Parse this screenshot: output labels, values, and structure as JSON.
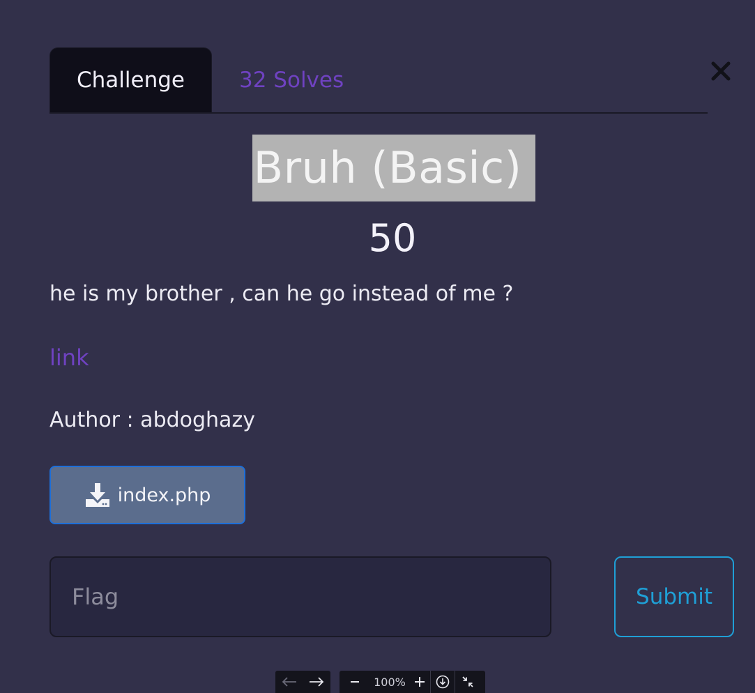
{
  "tabs": {
    "challenge": "Challenge",
    "solves": "32 Solves"
  },
  "challenge": {
    "title": "Bruh (Basic)",
    "points": "50",
    "description": "he is my brother , can he go instead of me ?",
    "link_text": "link",
    "author": "Author : abdoghazy"
  },
  "files": {
    "file_name": "index.php"
  },
  "form": {
    "flag_placeholder": "Flag",
    "submit_label": "Submit"
  },
  "viewer": {
    "zoom": "100%"
  },
  "colors": {
    "background": "#32304a",
    "accent_purple": "#6f42c1",
    "submit_blue": "#1f9fd6"
  },
  "icons": [
    "close-icon",
    "download-icon",
    "arrow-left-icon",
    "arrow-right-icon",
    "zoom-out-icon",
    "zoom-in-icon",
    "download-circle-icon",
    "collapse-icon"
  ]
}
